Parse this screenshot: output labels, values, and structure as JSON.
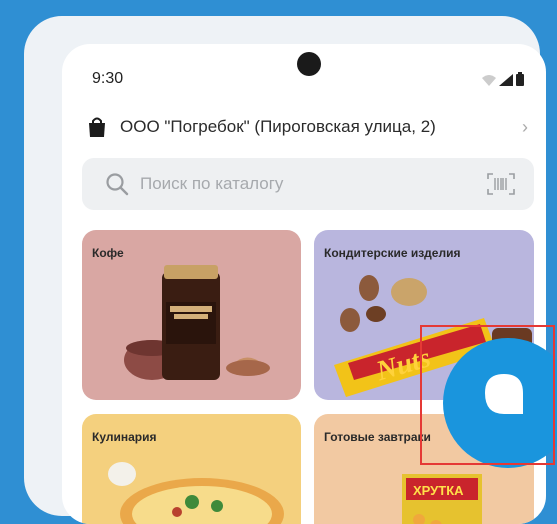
{
  "status_bar": {
    "time": "9:30"
  },
  "store": {
    "name": "ООО \"Погребок\" (Пироговская улица, 2)"
  },
  "search": {
    "placeholder": "Поиск по каталогу"
  },
  "categories": [
    {
      "label": "Кофе",
      "color": "#d9a7a3"
    },
    {
      "label": "Кондитерские изделия",
      "color": "#b9b6de"
    },
    {
      "label": "Кулинария",
      "color": "#f4d07e"
    },
    {
      "label": "Готовые завтраки",
      "color": "#f2c9a2"
    }
  ],
  "product_labels": {
    "coffee_brand": "NESCAFÉ GOLD",
    "candy": "Nuts",
    "cereal": "ХРУТКА"
  },
  "colors": {
    "background": "#2f8fd3",
    "chat_button": "#1a95dd",
    "highlight": "#e53935"
  }
}
